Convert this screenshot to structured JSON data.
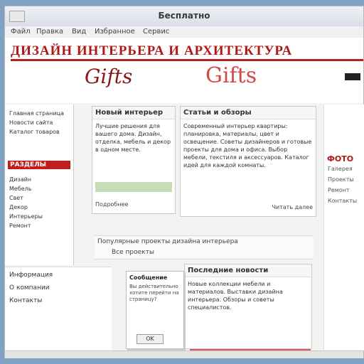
{
  "window": {
    "title": "Бесплатно"
  },
  "menu": {
    "items": [
      "Файл",
      "Правка",
      "Вид",
      "Избранное",
      "Сервис"
    ]
  },
  "masthead": {
    "brand": "ДИЗАЙН ИНТЕРЬЕРА И АРХИТЕКТУРА",
    "logo_left": "Gifts",
    "logo_right": "Gifts"
  },
  "left_column": {
    "top_items": [
      "Главная страница",
      "Новости сайта",
      "Каталог товаров"
    ],
    "section_title": "РАЗДЕЛЫ",
    "items": [
      "Дизайн",
      "Мебель",
      "Свет",
      "Декор",
      "Интерьеры",
      "Ремонт"
    ]
  },
  "panel_a": {
    "header": "Новый интерьер",
    "text": "Лучшие решения для вашего дома. Дизайн, отделка, мебель и декор в одном месте.",
    "caption": "Подробнее"
  },
  "panel_b": {
    "header": "Статьи и обзоры",
    "text": "Современный интерьер квартиры: планировка, материалы, цвет и освещение. Советы дизайнеров и готовые проекты для дома и офиса. Выбор мебели, текстиля и аксессуаров. Каталог идей для каждой комнаты.",
    "caption": "Читать далее"
  },
  "main_bar": {
    "line1": "Популярные проекты дизайна интерьера",
    "line2": "Все проекты"
  },
  "panel_c": {
    "header": "Последние новости",
    "text": "Новые коллекции мебели и материалов. Выставки дизайна интерьера. Обзоры и советы специалистов."
  },
  "right_column": {
    "heading": "ФОТО",
    "lines": [
      "Галерея",
      "Проекты",
      "Ремонт",
      "Контакты"
    ]
  },
  "bottom_left": {
    "heading": "Информация",
    "items": [
      "О компании",
      "Контакты"
    ]
  },
  "dialog": {
    "title": "Сообщение",
    "body": "Вы действительно хотите перейти на страницу?",
    "button": "OK"
  }
}
